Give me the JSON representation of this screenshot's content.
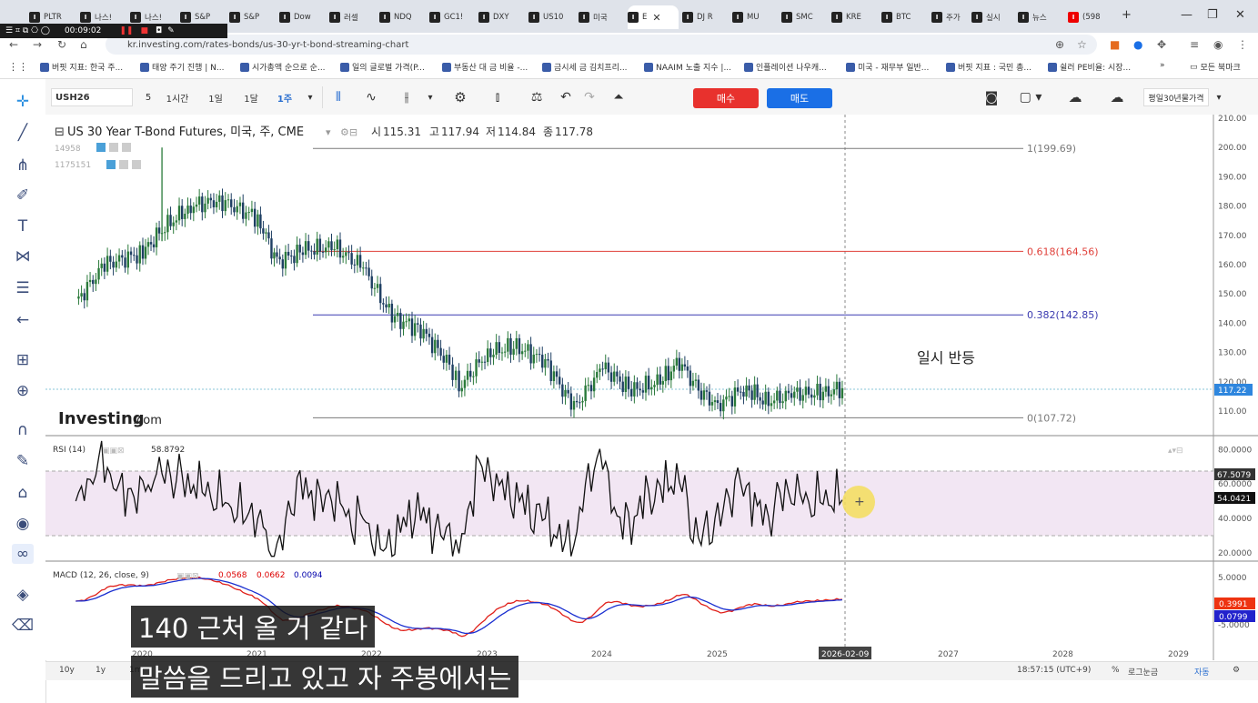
{
  "browser": {
    "tabs": [
      "PLTR",
      "나스!",
      "나스!",
      "S&P",
      "S&P",
      "Dow",
      "러셀",
      "NDQ",
      "GC1!",
      "DXY",
      "US10",
      "미국",
      "E",
      "DJ R",
      "MU",
      "SMC",
      "KRE",
      "BTC",
      "주가",
      "실시",
      "뉴스",
      "(598"
    ],
    "active_tab_index": 12,
    "new_tab": "+",
    "url": "kr.investing.com/rates-bonds/us-30-yr-t-bond-streaming-chart",
    "recording_time": "00:09:02",
    "bookmarks": [
      "버핏 지표: 한국 주...",
      "태양 주기 진행 | N...",
      "시가총액 순으로 순...",
      "일의 글로벌 가격(P...",
      "부동산 대 금 비율 -...",
      "금시세 금 김치프리...",
      "NAAIM 노출 지수 |...",
      "인플레이션 나우캐...",
      "미국 - 재무부 일반...",
      "버핏 지표 : 국민 총...",
      "쉴러 PE비율: 시장..."
    ],
    "bookmarks_more": "»",
    "all_bookmarks": "모든 북마크"
  },
  "toolbar": {
    "symbol": "USH26",
    "intervals": [
      "5",
      "1시간",
      "1일",
      "1달",
      "1주"
    ],
    "active_interval": "1주",
    "buy_label": "매수",
    "sell_label": "매도",
    "settings_label": "평일30년물가격"
  },
  "chart_header": {
    "title": "US 30 Year T-Bond Futures, 미국, 주, CME",
    "open_label": "시",
    "open": "115.31",
    "high_label": "고",
    "high": "117.94",
    "low_label": "저",
    "low": "114.84",
    "close_label": "종",
    "close": "117.78",
    "study1": "14958",
    "study2": "1175151",
    "watermark": "Investing",
    "watermark_suffix": ".com"
  },
  "annotation": "일시 반등",
  "fib_levels": [
    {
      "label": "1(199.69)",
      "value": 199.69,
      "color": "#7a7a7a"
    },
    {
      "label": "0.618(164.56)",
      "value": 164.56,
      "color": "#e0403a"
    },
    {
      "label": "0.382(142.85)",
      "value": 142.85,
      "color": "#3a3ab0"
    },
    {
      "label": "0(107.72)",
      "value": 107.72,
      "color": "#7a7a7a"
    }
  ],
  "price_axis": {
    "ticks": [
      "210.00",
      "200.00",
      "190.00",
      "180.00",
      "170.00",
      "160.00",
      "150.00",
      "140.00",
      "130.00",
      "120.00",
      "110.00"
    ],
    "last_price": "117.22"
  },
  "rsi": {
    "label": "RSI (14)",
    "value": "58.8792",
    "ticks": [
      "80.0000",
      "60.0000",
      "40.0000",
      "20.0000"
    ],
    "badge_upper": "67.5079",
    "badge_current": "54.0421"
  },
  "macd": {
    "label": "MACD (12, 26, close, 9)",
    "v1": "0.0568",
    "v2": "0.0662",
    "v3": "0.0094",
    "ticks": [
      "5.0000",
      "0.0000",
      "-5.0000"
    ],
    "badge1": "0.3991",
    "badge2": "0.0799"
  },
  "time_axis": {
    "labels": [
      "2020",
      "2021",
      "2022",
      "2023",
      "2024",
      "2025",
      "2026-02-09",
      "2027",
      "2028",
      "2029"
    ],
    "cursor_label": "2026-02-09"
  },
  "bottom_bar": {
    "ranges": [
      "10y",
      "1y",
      "1m"
    ],
    "clock": "18:57:15 (UTC+9)",
    "percent": "%",
    "log": "로그눈금",
    "auto": "자동"
  },
  "subtitles": [
    "140 근처 올 거 같다",
    "말씀을 드리고 있고 자 주봉에서는"
  ],
  "chart_data": {
    "type": "line",
    "title": "US 30 Year T-Bond Futures, 미국, 주, CME",
    "x": [
      "2019-06",
      "2019-09",
      "2020-01",
      "2020-03",
      "2020-06",
      "2020-09",
      "2021-01",
      "2021-03",
      "2021-06",
      "2021-09",
      "2021-12",
      "2022-03",
      "2022-06",
      "2022-09",
      "2022-10",
      "2023-01",
      "2023-04",
      "2023-07",
      "2023-10",
      "2024-01",
      "2024-04",
      "2024-07",
      "2024-09",
      "2024-11",
      "2025-01",
      "2025-04",
      "2025-06",
      "2025-09",
      "2025-12",
      "2026-02"
    ],
    "series": [
      {
        "values": [
          147,
          160,
          164,
          172,
          180,
          182,
          176,
          161,
          165,
          166,
          159,
          142,
          138,
          126,
          118,
          130,
          132,
          127,
          111,
          125,
          117,
          120,
          127,
          117,
          112,
          118,
          113,
          116,
          116,
          117.8
        ]
      }
    ],
    "ylim": [
      105,
      212
    ]
  }
}
